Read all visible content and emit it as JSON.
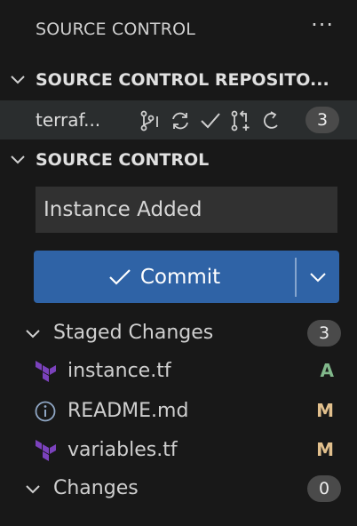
{
  "header": {
    "title": "SOURCE CONTROL",
    "more": "···"
  },
  "repositories": {
    "title": "SOURCE CONTROL REPOSITO...",
    "repo": {
      "name": "terraf...",
      "changes": "3"
    }
  },
  "source_control": {
    "title": "SOURCE CONTROL",
    "message": "Instance Added",
    "commit_label": "Commit",
    "staged": {
      "label": "Staged Changes",
      "count": "3",
      "files": [
        {
          "name": "instance.tf",
          "status": "A",
          "icon": "terraform-icon"
        },
        {
          "name": "README.md",
          "status": "M",
          "icon": "info-icon"
        },
        {
          "name": "variables.tf",
          "status": "M",
          "icon": "terraform-icon"
        }
      ]
    },
    "changes": {
      "label": "Changes",
      "count": "0"
    }
  },
  "colors": {
    "added": "#81b88b",
    "modified": "#e2c08d",
    "terraform": "#7b42bc",
    "commit_bg": "#2f63a6"
  }
}
